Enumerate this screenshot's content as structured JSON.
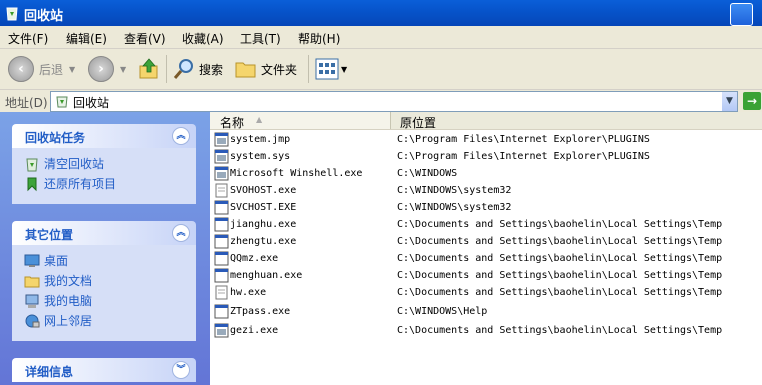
{
  "window": {
    "title": "回收站"
  },
  "menu": [
    "文件(F)",
    "编辑(E)",
    "查看(V)",
    "收藏(A)",
    "工具(T)",
    "帮助(H)"
  ],
  "toolbar": {
    "back": "后退",
    "search": "搜索",
    "folders": "文件夹"
  },
  "address": {
    "label": "地址(D)",
    "value": "回收站"
  },
  "left": {
    "tasks": {
      "title": "回收站任务",
      "items": [
        "清空回收站",
        "还原所有项目"
      ]
    },
    "places": {
      "title": "其它位置",
      "items": [
        "桌面",
        "我的文档",
        "我的电脑",
        "网上邻居"
      ]
    },
    "details": {
      "title": "详细信息"
    }
  },
  "columns": {
    "name": "名称",
    "location": "原位置"
  },
  "files": [
    {
      "name": "system.jmp",
      "location": "C:\\Program Files\\Internet Explorer\\PLUGINS",
      "icon": "app-icon"
    },
    {
      "name": "system.sys",
      "location": "C:\\Program Files\\Internet Explorer\\PLUGINS",
      "icon": "app-icon"
    },
    {
      "name": "Microsoft Winshell.exe",
      "location": "C:\\WINDOWS",
      "icon": "app-icon"
    },
    {
      "name": "SVOHOST.exe",
      "location": "C:\\WINDOWS\\system32",
      "icon": "blank-icon"
    },
    {
      "name": "SVCHOST.EXE",
      "location": "C:\\WINDOWS\\system32",
      "icon": "window-icon"
    },
    {
      "name": "jianghu.exe",
      "location": "C:\\Documents and Settings\\baohelin\\Local Settings\\Temp",
      "icon": "window-icon"
    },
    {
      "name": "zhengtu.exe",
      "location": "C:\\Documents and Settings\\baohelin\\Local Settings\\Temp",
      "icon": "window-icon"
    },
    {
      "name": "QQmz.exe",
      "location": "C:\\Documents and Settings\\baohelin\\Local Settings\\Temp",
      "icon": "window-icon"
    },
    {
      "name": "menghuan.exe",
      "location": "C:\\Documents and Settings\\baohelin\\Local Settings\\Temp",
      "icon": "window-icon"
    },
    {
      "name": "hw.exe",
      "location": "C:\\Documents and Settings\\baohelin\\Local Settings\\Temp",
      "icon": "blank-icon"
    },
    {
      "name": "ZTpass.exe",
      "location": "C:\\WINDOWS\\Help",
      "icon": "window-icon"
    },
    {
      "name": "gezi.exe",
      "location": "C:\\Documents and Settings\\baohelin\\Local Settings\\Temp",
      "icon": "app-icon"
    }
  ]
}
